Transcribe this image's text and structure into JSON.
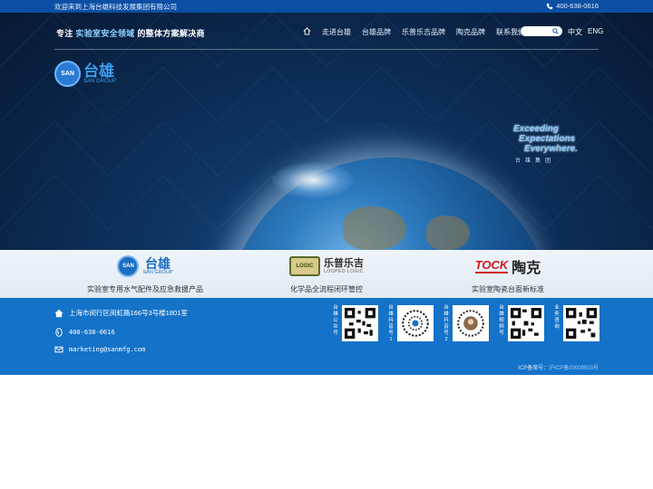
{
  "topbar": {
    "welcome": "欢迎来到上海台雄科技发展集团有限公司",
    "phone": "400-638-0616",
    "phone_icon": "phone-icon"
  },
  "header": {
    "slogan_prefix": "专注",
    "slogan_highlight": "实验室安全领域",
    "slogan_suffix": "的整体方案解决商",
    "nav": [
      "走进台雄",
      "台雄品牌",
      "乐普乐吉品牌",
      "陶克品牌",
      "联系我们"
    ],
    "home_icon": "home-icon",
    "search_icon": "search-icon",
    "lang_cn": "中文",
    "lang_en": "ENG"
  },
  "hero": {
    "logo_cn": "台雄",
    "logo_en": "SAN GROUP",
    "logo_mark": "SAN",
    "tagline": [
      "Exceeding",
      "Expectations",
      "Everywhere."
    ],
    "tagline_cn": "台雄集团"
  },
  "brands": [
    {
      "mark": "SAN",
      "name": "台雄",
      "sub": "SAN GROUP",
      "caption": "实验室专用水气配件及应急救援产品"
    },
    {
      "mark": "LOGIC",
      "name": "乐普乐吉",
      "sub": "LOOPED LOGIC",
      "caption": "化学品全流程闭环管控"
    },
    {
      "mark": "TOCK",
      "name": "陶克",
      "caption": "实验室陶瓷台面新标准"
    }
  ],
  "footer": {
    "address": "上海市闵行区闵虹路166号3号楼1801室",
    "phone": "400-638-0616",
    "email": "marketing@sanmfg.com",
    "icons": {
      "address": "home-icon",
      "phone": "phone-icon",
      "email": "mail-icon"
    },
    "qr_labels": [
      "台雄公众号",
      "台雄抖音号1",
      "台雄抖音号2",
      "台雄视频号",
      "业务咨询"
    ],
    "icp_label": "ICP备案号：",
    "icp_number": "沪ICP备20009503号"
  },
  "colors": {
    "topbar": "#0a4fa3",
    "footer": "#1472c8",
    "accent": "#3a9df0",
    "tock_red": "#d0191a"
  }
}
